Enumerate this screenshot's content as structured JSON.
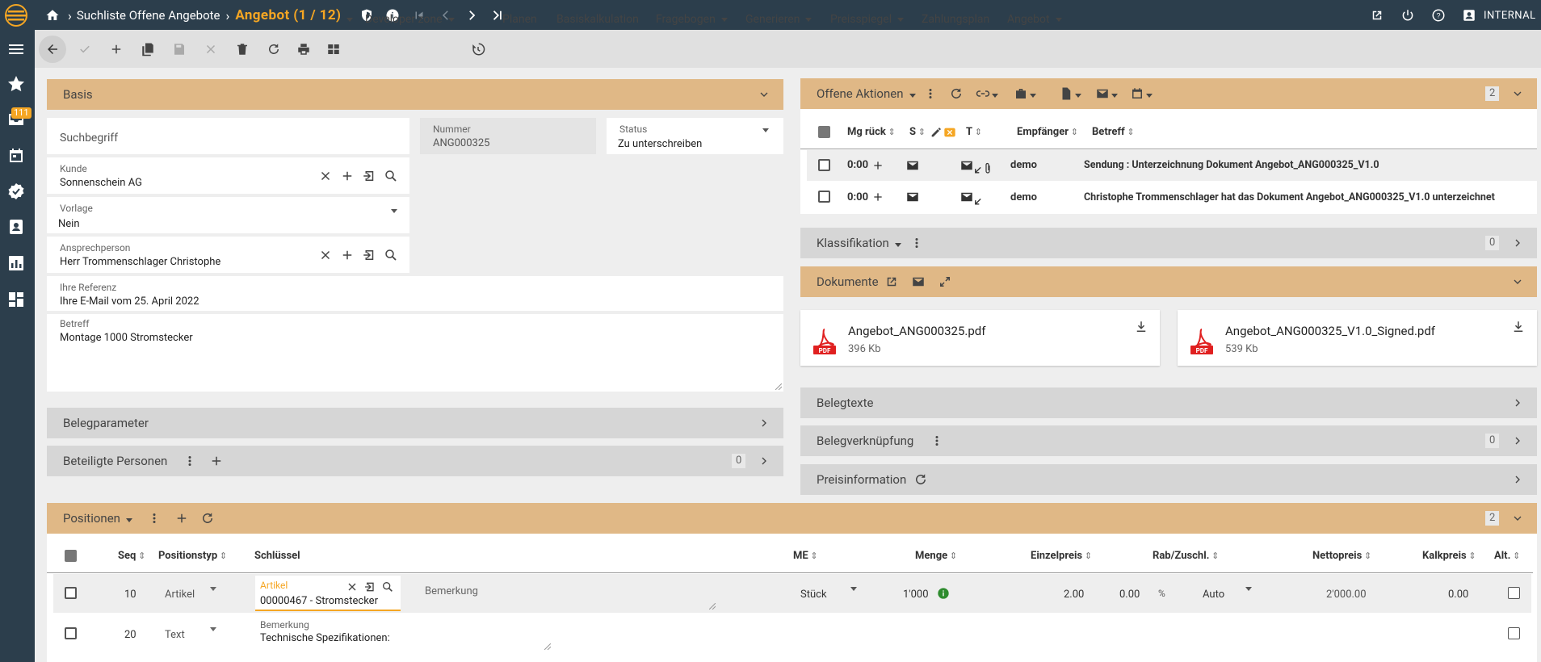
{
  "topbar": {
    "breadcrumb": "Suchliste Offene Angebote",
    "title": "Angebot (1 / 12)",
    "user": "INTERNAL"
  },
  "sidebar": {
    "badge": "111"
  },
  "toolbar": {
    "developer_zone": "Developer zone",
    "planen": "Planen",
    "basiskalkulation": "Basiskalkulation",
    "fragebogen": "Fragebogen",
    "generieren": "Generieren",
    "preisspiegel": "Preisspiegel",
    "zahlungsplan": "Zahlungsplan",
    "angebot": "Angebot"
  },
  "basis": {
    "title": "Basis",
    "suchbegriff_placeholder": "Suchbegriff",
    "nummer_label": "Nummer",
    "nummer": "ANG000325",
    "status_label": "Status",
    "status": "Zu unterschreiben",
    "kunde_label": "Kunde",
    "kunde": "Sonnenschein AG",
    "vorlage_label": "Vorlage",
    "vorlage": "Nein",
    "ansprech_label": "Ansprechperson",
    "ansprech": "Herr Trommenschlager Christophe",
    "referenz_label": "Ihre Referenz",
    "referenz": "Ihre E-Mail vom 25. April 2022",
    "betreff_label": "Betreff",
    "betreff": "Montage 1000 Stromstecker"
  },
  "belegparameter": {
    "title": "Belegparameter"
  },
  "beteiligte": {
    "title": "Beteiligte Personen",
    "count": "0"
  },
  "offene": {
    "title": "Offene Aktionen",
    "count": "2",
    "headers": {
      "mg": "Mg rück",
      "s": "S",
      "t": "T",
      "empf": "Empfänger",
      "betreff": "Betreff"
    },
    "rows": [
      {
        "mg": "0:00",
        "empf": "demo",
        "betreff": "Sendung : Unterzeichnung Dokument Angebot_ANG000325_V1.0"
      },
      {
        "mg": "0:00",
        "empf": "demo",
        "betreff": "Christophe Trommenschlager hat das Dokument Angebot_ANG000325_V1.0 unterzeichnet"
      }
    ]
  },
  "klassifikation": {
    "title": "Klassifikation",
    "count": "0"
  },
  "dokumente": {
    "title": "Dokumente",
    "files": [
      {
        "name": "Angebot_ANG000325.pdf",
        "size": "396 Kb",
        "type": "PDF"
      },
      {
        "name": "Angebot_ANG000325_V1.0_Signed.pdf",
        "size": "539 Kb",
        "type": "PDF"
      }
    ]
  },
  "belegtexte": {
    "title": "Belegtexte"
  },
  "belegverkn": {
    "title": "Belegverknüpfung",
    "count": "0"
  },
  "preisinfo": {
    "title": "Preisinformation"
  },
  "positionen": {
    "title": "Positionen",
    "count": "2",
    "headers": {
      "seq": "Seq",
      "typ": "Positionstyp",
      "schluessel": "Schlüssel",
      "me": "ME",
      "menge": "Menge",
      "einzel": "Einzelpreis",
      "rab": "Rab/Zuschl.",
      "netto": "Nettopreis",
      "kalk": "Kalkpreis",
      "alt": "Alt."
    },
    "rows": [
      {
        "seq": "10",
        "typ": "Artikel",
        "field_label": "Artikel",
        "key": "00000467 - Stromstecker",
        "bemerkung_placeholder": "Bemerkung",
        "me": "Stück",
        "menge": "1'000",
        "einzel": "2.00",
        "rab": "0.00",
        "pct": "%",
        "mode": "Auto",
        "netto": "2'000.00",
        "kalk": "0.00"
      },
      {
        "seq": "20",
        "typ": "Text",
        "field_label": "Bemerkung",
        "key": "Technische Spezifikationen:"
      }
    ]
  },
  "colors": {
    "accent": "#f5a623",
    "section": "#e0b886",
    "dark": "#2c3e4c"
  }
}
